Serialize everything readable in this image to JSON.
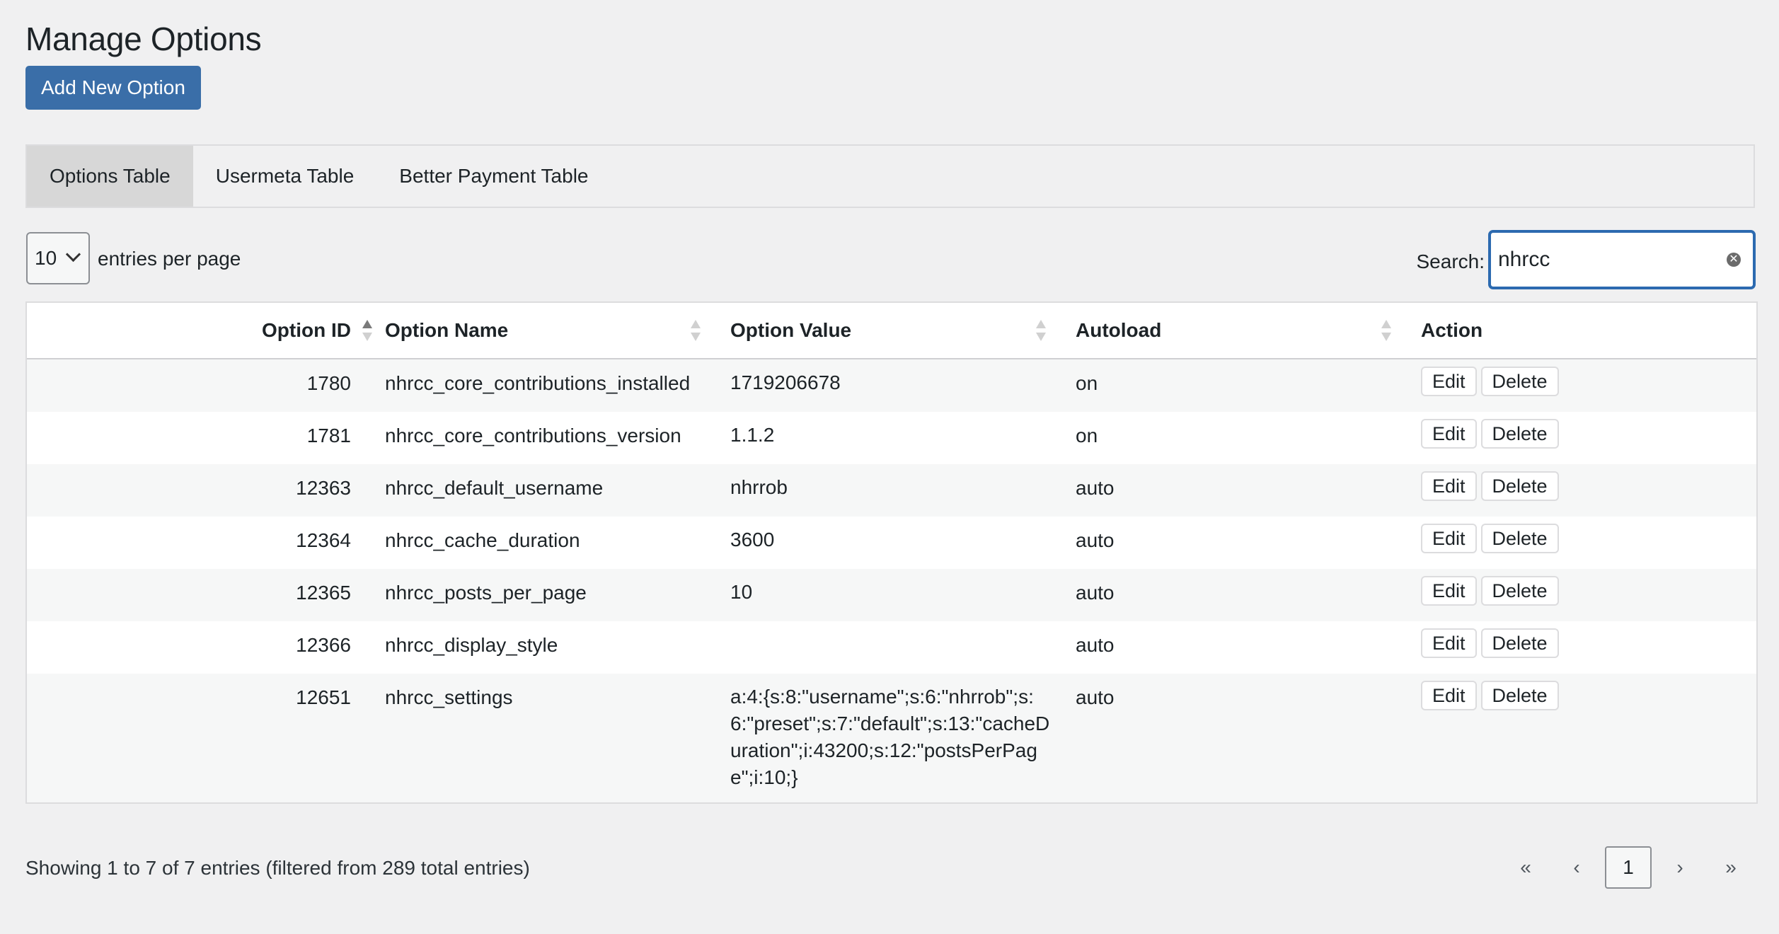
{
  "page": {
    "title": "Manage Options",
    "add_button": "Add New Option"
  },
  "tabs": [
    {
      "label": "Options Table",
      "active": true
    },
    {
      "label": "Usermeta Table",
      "active": false
    },
    {
      "label": "Better Payment Table",
      "active": false
    }
  ],
  "controls": {
    "per_page_value": "10",
    "per_page_label": "entries per page",
    "search_label": "Search:",
    "search_value": "nhrcc"
  },
  "table": {
    "headers": [
      "Option ID",
      "Option Name",
      "Option Value",
      "Autoload",
      "Action"
    ],
    "rows": [
      {
        "id": "1780",
        "name": "nhrcc_core_contributions_installed",
        "value": "1719206678",
        "autoload": "on"
      },
      {
        "id": "1781",
        "name": "nhrcc_core_contributions_version",
        "value": "1.1.2",
        "autoload": "on"
      },
      {
        "id": "12363",
        "name": "nhrcc_default_username",
        "value": "nhrrob",
        "autoload": "auto"
      },
      {
        "id": "12364",
        "name": "nhrcc_cache_duration",
        "value": "3600",
        "autoload": "auto"
      },
      {
        "id": "12365",
        "name": "nhrcc_posts_per_page",
        "value": "10",
        "autoload": "auto"
      },
      {
        "id": "12366",
        "name": "nhrcc_display_style",
        "value": "",
        "autoload": "auto"
      },
      {
        "id": "12651",
        "name": "nhrcc_settings",
        "value": "a:4:{s:8:\"username\";s:6:\"nhrrob\";s:6:\"preset\";s:7:\"default\";s:13:\"cacheDuration\";i:43200;s:12:\"postsPerPage\";i:10;}",
        "autoload": "auto"
      }
    ],
    "edit_label": "Edit",
    "delete_label": "Delete"
  },
  "footer": {
    "info": "Showing 1 to 7 of 7 entries (filtered from 289 total entries)",
    "first": "«",
    "prev": "‹",
    "current": "1",
    "next": "›",
    "last": "»"
  },
  "colors": {
    "primary": "#3a6ea8",
    "search_focus": "#2c6ab0"
  },
  "icons": {
    "sort": "sort-arrows-icon",
    "clear": "clear-search-icon",
    "select": "chevron-down-icon"
  }
}
